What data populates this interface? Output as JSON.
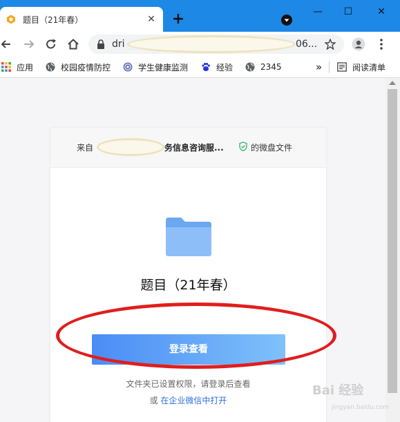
{
  "browser": {
    "tab_title": "题目（21年春）",
    "tab_close": "✕",
    "new_tab": "+",
    "window": {
      "minimize": "—",
      "maximize": "☐",
      "close": "✕"
    },
    "url_visible_start": "dri",
    "url_visible_end": "06..."
  },
  "bookmarks": [
    {
      "label": "应用",
      "icon": "apps-grid-icon"
    },
    {
      "label": "校园疫情防控",
      "icon": "globe-icon"
    },
    {
      "label": "学生健康监测",
      "icon": "emblem-icon"
    },
    {
      "label": "经验",
      "icon": "baidu-paw-icon"
    },
    {
      "label": "2345",
      "icon": "globe-icon"
    }
  ],
  "bookmarks_more": "»",
  "reading_list": "阅读清单",
  "share": {
    "from_label": "来自",
    "company_suffix": "务信息咨询服...",
    "suffix": "的微盘文件",
    "file_title": "题目（21年春）",
    "login_button": "登录查看",
    "permission_note": "文件夹已设置权限，请登录后查看",
    "alt_prefix": "或",
    "alt_link": "在企业微信中打开"
  },
  "watermark": {
    "main": "Bai 经验",
    "sub": "jingyan.baidu.com"
  },
  "colors": {
    "titlebar": "#1d88e6",
    "button_start": "#4a8cf5",
    "button_end": "#7fc1fa",
    "annotation_red": "#e11d1d",
    "link": "#2f6fe0"
  }
}
